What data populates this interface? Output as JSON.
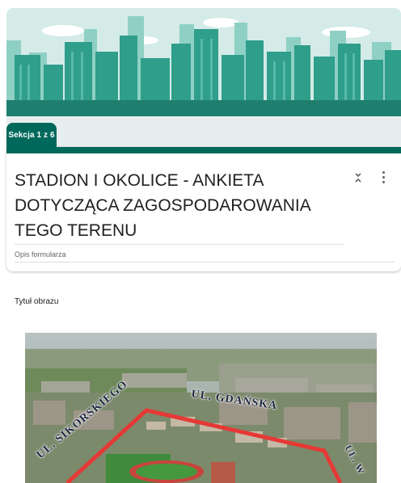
{
  "section": {
    "label": "Sekcja 1 z 6"
  },
  "form": {
    "title": "STADION I OKOLICE - ANKIETA DOTYCZĄCA ZAGOSPODAROWANIA TEGO TERENU",
    "description_placeholder": "Opis formularza"
  },
  "image_item": {
    "title": "Tytuł obrazu",
    "street_labels": {
      "top": "UL. GDAŃSKA",
      "left": "UL. SIKORSKIEGO",
      "right": "UL. W"
    }
  },
  "colors": {
    "accent": "#00695c",
    "header_sky": "#cfe7e5",
    "header_buildings": "#2e9c8a",
    "boundary": "#e53935"
  },
  "icons": {
    "collapse": "unfold-less-icon",
    "more": "more-vert-icon"
  }
}
